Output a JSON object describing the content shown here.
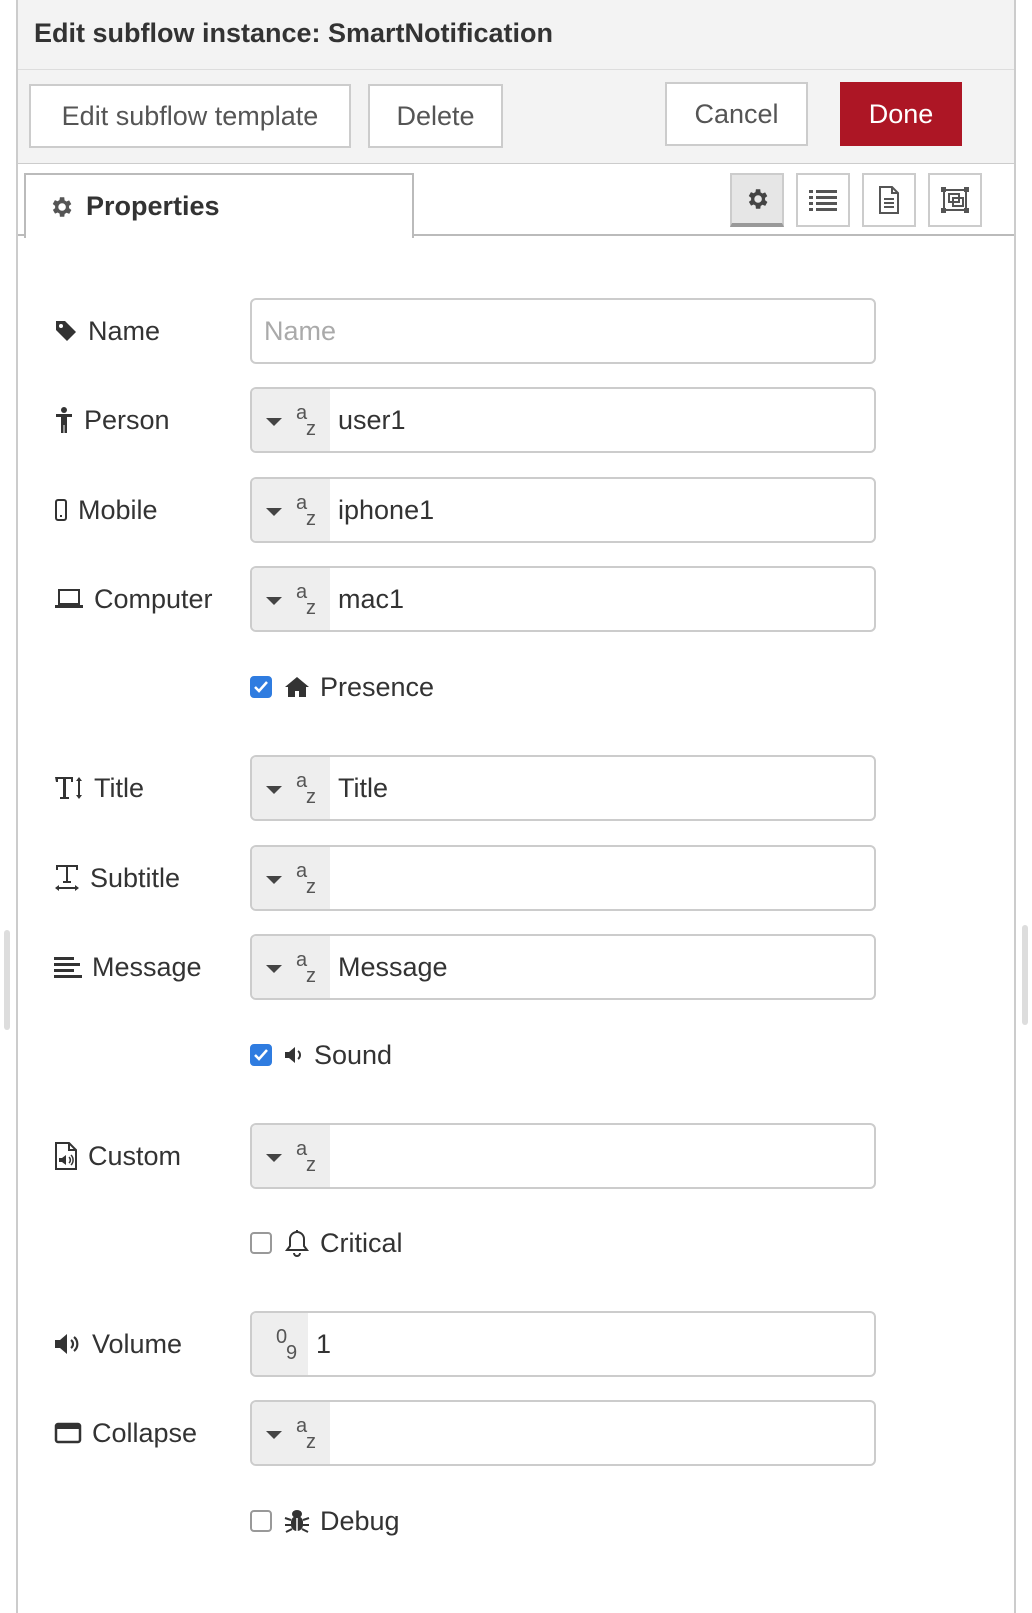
{
  "window": {
    "title": "Edit subflow instance: SmartNotification"
  },
  "toolbar": {
    "edit_template_label": "Edit subflow template",
    "delete_label": "Delete",
    "cancel_label": "Cancel",
    "done_label": "Done"
  },
  "tabs": {
    "properties_label": "Properties"
  },
  "colors": {
    "done": "#ad1625",
    "checkbox": "#2f7ce0"
  },
  "form": {
    "name": {
      "label": "Name",
      "placeholder": "Name",
      "value": ""
    },
    "person": {
      "label": "Person",
      "value": "user1"
    },
    "mobile": {
      "label": "Mobile",
      "value": "iphone1"
    },
    "computer": {
      "label": "Computer",
      "value": "mac1"
    },
    "presence": {
      "label": "Presence",
      "checked": true
    },
    "title": {
      "label": "Title",
      "value": "Title"
    },
    "subtitle": {
      "label": "Subtitle",
      "value": ""
    },
    "message": {
      "label": "Message",
      "value": "Message"
    },
    "sound": {
      "label": "Sound",
      "checked": true
    },
    "custom": {
      "label": "Custom",
      "value": ""
    },
    "critical": {
      "label": "Critical",
      "checked": false
    },
    "volume": {
      "label": "Volume",
      "value": "1"
    },
    "collapse": {
      "label": "Collapse",
      "value": ""
    },
    "debug": {
      "label": "Debug",
      "checked": false
    }
  }
}
